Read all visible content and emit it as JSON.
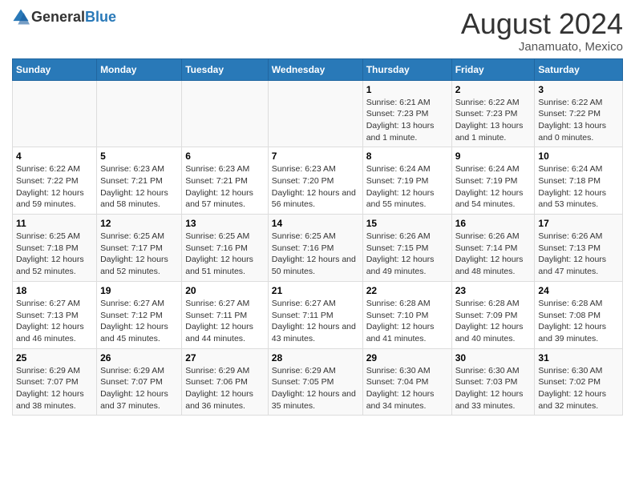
{
  "header": {
    "logo_general": "General",
    "logo_blue": "Blue",
    "main_title": "August 2024",
    "subtitle": "Janamuato, Mexico"
  },
  "days_of_week": [
    "Sunday",
    "Monday",
    "Tuesday",
    "Wednesday",
    "Thursday",
    "Friday",
    "Saturday"
  ],
  "weeks": [
    [
      {
        "day": "",
        "info": ""
      },
      {
        "day": "",
        "info": ""
      },
      {
        "day": "",
        "info": ""
      },
      {
        "day": "",
        "info": ""
      },
      {
        "day": "1",
        "info": "Sunrise: 6:21 AM\nSunset: 7:23 PM\nDaylight: 13 hours and 1 minute."
      },
      {
        "day": "2",
        "info": "Sunrise: 6:22 AM\nSunset: 7:23 PM\nDaylight: 13 hours and 1 minute."
      },
      {
        "day": "3",
        "info": "Sunrise: 6:22 AM\nSunset: 7:22 PM\nDaylight: 13 hours and 0 minutes."
      }
    ],
    [
      {
        "day": "4",
        "info": "Sunrise: 6:22 AM\nSunset: 7:22 PM\nDaylight: 12 hours and 59 minutes."
      },
      {
        "day": "5",
        "info": "Sunrise: 6:23 AM\nSunset: 7:21 PM\nDaylight: 12 hours and 58 minutes."
      },
      {
        "day": "6",
        "info": "Sunrise: 6:23 AM\nSunset: 7:21 PM\nDaylight: 12 hours and 57 minutes."
      },
      {
        "day": "7",
        "info": "Sunrise: 6:23 AM\nSunset: 7:20 PM\nDaylight: 12 hours and 56 minutes."
      },
      {
        "day": "8",
        "info": "Sunrise: 6:24 AM\nSunset: 7:19 PM\nDaylight: 12 hours and 55 minutes."
      },
      {
        "day": "9",
        "info": "Sunrise: 6:24 AM\nSunset: 7:19 PM\nDaylight: 12 hours and 54 minutes."
      },
      {
        "day": "10",
        "info": "Sunrise: 6:24 AM\nSunset: 7:18 PM\nDaylight: 12 hours and 53 minutes."
      }
    ],
    [
      {
        "day": "11",
        "info": "Sunrise: 6:25 AM\nSunset: 7:18 PM\nDaylight: 12 hours and 52 minutes."
      },
      {
        "day": "12",
        "info": "Sunrise: 6:25 AM\nSunset: 7:17 PM\nDaylight: 12 hours and 52 minutes."
      },
      {
        "day": "13",
        "info": "Sunrise: 6:25 AM\nSunset: 7:16 PM\nDaylight: 12 hours and 51 minutes."
      },
      {
        "day": "14",
        "info": "Sunrise: 6:25 AM\nSunset: 7:16 PM\nDaylight: 12 hours and 50 minutes."
      },
      {
        "day": "15",
        "info": "Sunrise: 6:26 AM\nSunset: 7:15 PM\nDaylight: 12 hours and 49 minutes."
      },
      {
        "day": "16",
        "info": "Sunrise: 6:26 AM\nSunset: 7:14 PM\nDaylight: 12 hours and 48 minutes."
      },
      {
        "day": "17",
        "info": "Sunrise: 6:26 AM\nSunset: 7:13 PM\nDaylight: 12 hours and 47 minutes."
      }
    ],
    [
      {
        "day": "18",
        "info": "Sunrise: 6:27 AM\nSunset: 7:13 PM\nDaylight: 12 hours and 46 minutes."
      },
      {
        "day": "19",
        "info": "Sunrise: 6:27 AM\nSunset: 7:12 PM\nDaylight: 12 hours and 45 minutes."
      },
      {
        "day": "20",
        "info": "Sunrise: 6:27 AM\nSunset: 7:11 PM\nDaylight: 12 hours and 44 minutes."
      },
      {
        "day": "21",
        "info": "Sunrise: 6:27 AM\nSunset: 7:11 PM\nDaylight: 12 hours and 43 minutes."
      },
      {
        "day": "22",
        "info": "Sunrise: 6:28 AM\nSunset: 7:10 PM\nDaylight: 12 hours and 41 minutes."
      },
      {
        "day": "23",
        "info": "Sunrise: 6:28 AM\nSunset: 7:09 PM\nDaylight: 12 hours and 40 minutes."
      },
      {
        "day": "24",
        "info": "Sunrise: 6:28 AM\nSunset: 7:08 PM\nDaylight: 12 hours and 39 minutes."
      }
    ],
    [
      {
        "day": "25",
        "info": "Sunrise: 6:29 AM\nSunset: 7:07 PM\nDaylight: 12 hours and 38 minutes."
      },
      {
        "day": "26",
        "info": "Sunrise: 6:29 AM\nSunset: 7:07 PM\nDaylight: 12 hours and 37 minutes."
      },
      {
        "day": "27",
        "info": "Sunrise: 6:29 AM\nSunset: 7:06 PM\nDaylight: 12 hours and 36 minutes."
      },
      {
        "day": "28",
        "info": "Sunrise: 6:29 AM\nSunset: 7:05 PM\nDaylight: 12 hours and 35 minutes."
      },
      {
        "day": "29",
        "info": "Sunrise: 6:30 AM\nSunset: 7:04 PM\nDaylight: 12 hours and 34 minutes."
      },
      {
        "day": "30",
        "info": "Sunrise: 6:30 AM\nSunset: 7:03 PM\nDaylight: 12 hours and 33 minutes."
      },
      {
        "day": "31",
        "info": "Sunrise: 6:30 AM\nSunset: 7:02 PM\nDaylight: 12 hours and 32 minutes."
      }
    ]
  ]
}
